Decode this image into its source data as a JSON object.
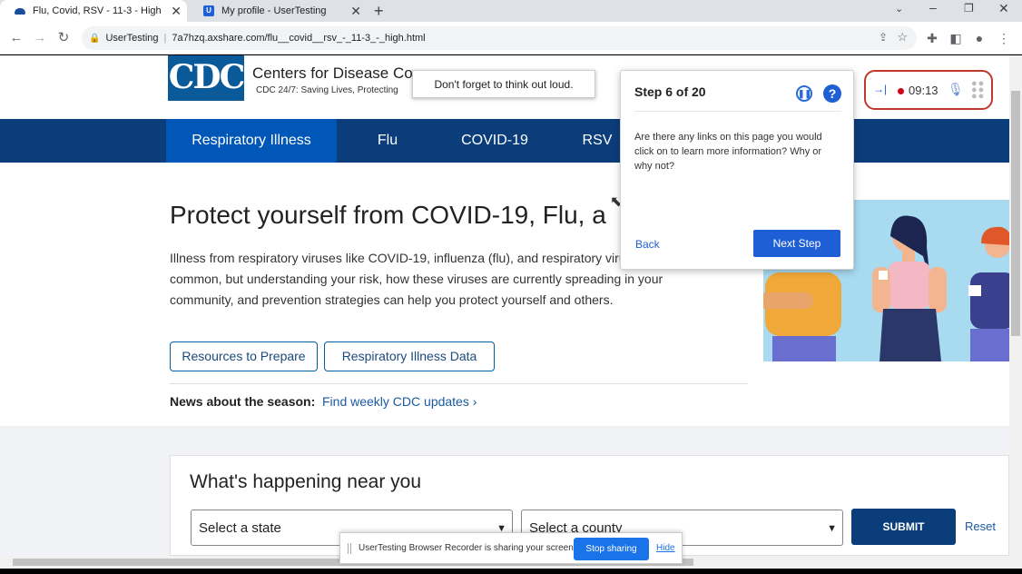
{
  "browser": {
    "tabs": [
      {
        "title": "Flu, Covid, RSV - 11-3 - High",
        "active": true
      },
      {
        "title": "My profile - UserTesting",
        "active": false
      }
    ],
    "address": {
      "site_label": "UserTesting",
      "url": "7a7hzq.axshare.com/flu__covid__rsv_-_11-3_-_high.html"
    }
  },
  "site": {
    "logo_text": "CDC",
    "title": "Centers for Disease Co",
    "tagline": "CDC 24/7: Saving Lives, Protecting",
    "nav": [
      "Respiratory Illness",
      "Flu",
      "COVID-19",
      "RSV"
    ],
    "hero_title": "Protect yourself from COVID-19, Flu, a",
    "hero_text": "Illness from respiratory viruses like COVID-19, influenza (flu), and respiratory virus (RSV) is common, but understanding your risk, how these viruses are currently spreading in your community, and prevention strategies can help you protect yourself and others.",
    "buttons": {
      "resources": "Resources to Prepare",
      "data": "Respiratory Illness Data"
    },
    "news_label": "News about the season:",
    "news_link": "Find weekly CDC updates",
    "near_title": "What's happening near you",
    "state_select": "Select a state",
    "county_select": "Select a county",
    "submit": "SUBMIT",
    "reset": "Reset"
  },
  "tooltip": "Don't forget to think out loud.",
  "ut_panel": {
    "step": "Step 6 of 20",
    "question": "Are there any links on this page you would click on to learn more information? Why or why not?",
    "back": "Back",
    "next": "Next Step"
  },
  "recorder": {
    "time": "09:13"
  },
  "share_bar": {
    "text": "UserTesting Browser Recorder is sharing your screen.",
    "stop": "Stop sharing",
    "hide": "Hide"
  },
  "colors": {
    "cdc_navy": "#0a3d7a",
    "cdc_active_nav": "#0057b7",
    "ut_blue": "#1f5fd6",
    "recorder_border": "#c0392b"
  }
}
